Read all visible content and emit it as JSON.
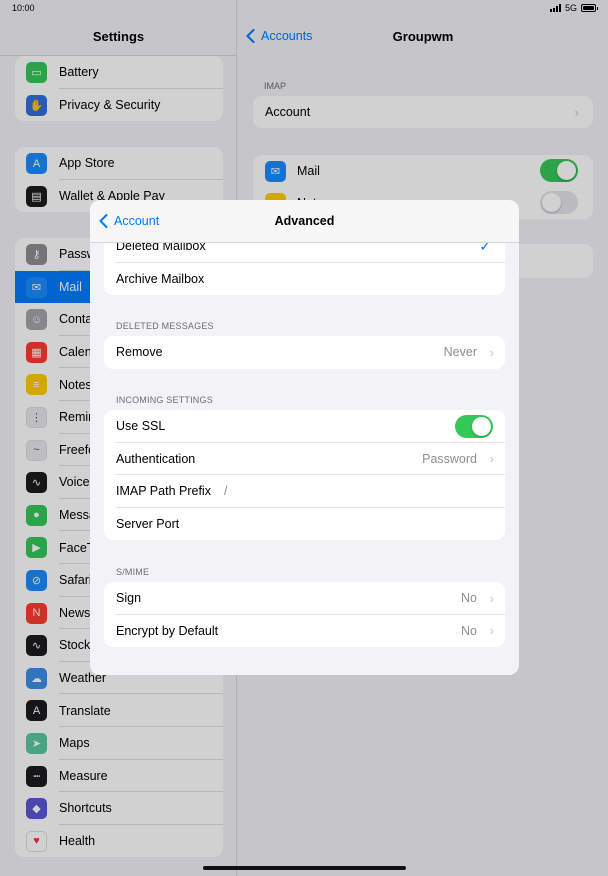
{
  "status_bar": {
    "time": "10:00",
    "network": "5G"
  },
  "sidebar": {
    "title": "Settings",
    "groups": [
      [
        {
          "label": "Battery",
          "icon": "battery-icon",
          "color": "#34c759",
          "glyph": "▭"
        },
        {
          "label": "Privacy & Security",
          "icon": "hand-icon",
          "color": "#2f6fe0",
          "glyph": "✋"
        }
      ],
      [
        {
          "label": "App Store",
          "icon": "app-store-icon",
          "color": "#1a8cff",
          "glyph": "A"
        },
        {
          "label": "Wallet & Apple Pay",
          "icon": "wallet-icon",
          "color": "#1c1c1e",
          "glyph": "▤"
        }
      ],
      [
        {
          "label": "Passwords",
          "icon": "key-icon",
          "color": "#8e8e93",
          "glyph": "⚷"
        },
        {
          "label": "Mail",
          "icon": "mail-icon",
          "color": "#1a8cff",
          "glyph": "✉",
          "selected": true
        },
        {
          "label": "Contacts",
          "icon": "contacts-icon",
          "color": "#a5a5aa",
          "glyph": "☺"
        },
        {
          "label": "Calendar",
          "icon": "calendar-icon",
          "color": "#ff3b30",
          "glyph": "▦"
        },
        {
          "label": "Notes",
          "icon": "notes-icon",
          "color": "#ffcc00",
          "glyph": "≡"
        },
        {
          "label": "Reminders",
          "icon": "reminders-icon",
          "color": "#e8e8ed",
          "glyph": "⋮"
        },
        {
          "label": "Freeform",
          "icon": "freeform-icon",
          "color": "#e8e8ed",
          "glyph": "~"
        },
        {
          "label": "Voice Memos",
          "icon": "voice-memos-icon",
          "color": "#1c1c1e",
          "glyph": "∿"
        },
        {
          "label": "Messages",
          "icon": "messages-icon",
          "color": "#34c759",
          "glyph": "●"
        },
        {
          "label": "FaceTime",
          "icon": "facetime-icon",
          "color": "#34c759",
          "glyph": "▶"
        },
        {
          "label": "Safari",
          "icon": "safari-icon",
          "color": "#1a8cff",
          "glyph": "⊘"
        },
        {
          "label": "News",
          "icon": "news-icon",
          "color": "#ff3b30",
          "glyph": "N"
        },
        {
          "label": "Stocks",
          "icon": "stocks-icon",
          "color": "#1c1c1e",
          "glyph": "∿"
        },
        {
          "label": "Weather",
          "icon": "weather-icon",
          "color": "#3a8ee6",
          "glyph": "☁"
        },
        {
          "label": "Translate",
          "icon": "translate-icon",
          "color": "#1c1c1e",
          "glyph": "A"
        },
        {
          "label": "Maps",
          "icon": "maps-icon",
          "color": "#5ac8a0",
          "glyph": "➤"
        },
        {
          "label": "Measure",
          "icon": "measure-icon",
          "color": "#1c1c1e",
          "glyph": "┉"
        },
        {
          "label": "Shortcuts",
          "icon": "shortcuts-icon",
          "color": "#5856d6",
          "glyph": "◆"
        },
        {
          "label": "Health",
          "icon": "health-icon",
          "color": "#ffffff",
          "glyph": "♥"
        }
      ]
    ]
  },
  "detail": {
    "back_label": "Accounts",
    "title": "Groupwm",
    "imap_section": "IMAP",
    "account_label": "Account",
    "mail_label": "Mail",
    "notes_label": "Notes",
    "mail_toggle": true,
    "notes_toggle": false
  },
  "modal": {
    "back_label": "Account",
    "title": "Advanced",
    "mailbox_rows": [
      {
        "label": "Deleted Mailbox",
        "checked": true
      },
      {
        "label": "Archive Mailbox"
      }
    ],
    "deleted_messages_section": "DELETED MESSAGES",
    "remove": {
      "label": "Remove",
      "value": "Never"
    },
    "incoming_section": "INCOMING SETTINGS",
    "use_ssl": {
      "label": "Use SSL",
      "on": true
    },
    "authentication": {
      "label": "Authentication",
      "value": "Password"
    },
    "imap_path_prefix": {
      "label": "IMAP Path Prefix",
      "value": "/"
    },
    "server_port": {
      "label": "Server Port",
      "value": ""
    },
    "smime_section": "S/MIME",
    "sign": {
      "label": "Sign",
      "value": "No"
    },
    "encrypt": {
      "label": "Encrypt by Default",
      "value": "No"
    }
  },
  "colors": {
    "accent": "#007aff",
    "toggle_on": "#34c759"
  }
}
